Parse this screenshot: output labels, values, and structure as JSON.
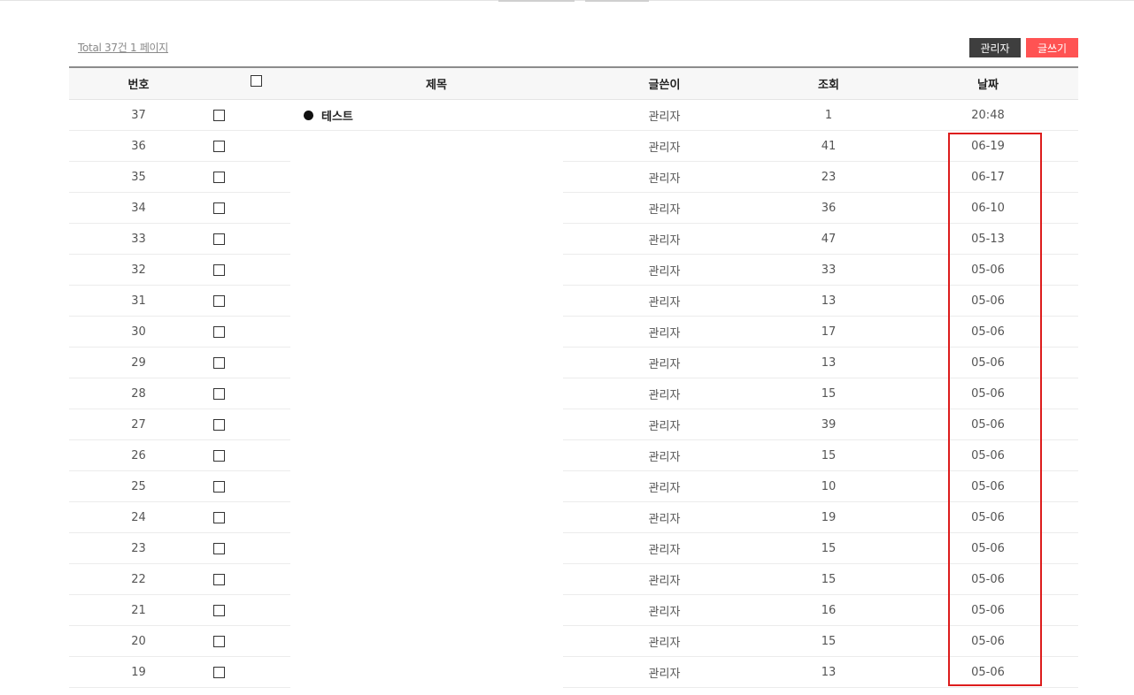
{
  "total_text": "Total 37건 1 페이지",
  "buttons": {
    "admin": "관리자",
    "write": "글쓰기"
  },
  "columns": {
    "number": "번호",
    "title": "제목",
    "author": "글쓴이",
    "views": "조회",
    "date": "날짜"
  },
  "rows": [
    {
      "num": "37",
      "title": "테스트",
      "author": "관리자",
      "views": "1",
      "date": "20:48"
    },
    {
      "num": "36",
      "title": "",
      "author": "관리자",
      "views": "41",
      "date": "06-19"
    },
    {
      "num": "35",
      "title": "",
      "author": "관리자",
      "views": "23",
      "date": "06-17"
    },
    {
      "num": "34",
      "title": "",
      "author": "관리자",
      "views": "36",
      "date": "06-10"
    },
    {
      "num": "33",
      "title": "",
      "author": "관리자",
      "views": "47",
      "date": "05-13"
    },
    {
      "num": "32",
      "title": "",
      "author": "관리자",
      "views": "33",
      "date": "05-06"
    },
    {
      "num": "31",
      "title": "",
      "author": "관리자",
      "views": "13",
      "date": "05-06"
    },
    {
      "num": "30",
      "title": "",
      "author": "관리자",
      "views": "17",
      "date": "05-06"
    },
    {
      "num": "29",
      "title": "",
      "author": "관리자",
      "views": "13",
      "date": "05-06"
    },
    {
      "num": "28",
      "title": "",
      "author": "관리자",
      "views": "15",
      "date": "05-06"
    },
    {
      "num": "27",
      "title": "",
      "author": "관리자",
      "views": "39",
      "date": "05-06"
    },
    {
      "num": "26",
      "title": "",
      "author": "관리자",
      "views": "15",
      "date": "05-06"
    },
    {
      "num": "25",
      "title": "",
      "author": "관리자",
      "views": "10",
      "date": "05-06"
    },
    {
      "num": "24",
      "title": "",
      "author": "관리자",
      "views": "19",
      "date": "05-06"
    },
    {
      "num": "23",
      "title": "",
      "author": "관리자",
      "views": "15",
      "date": "05-06"
    },
    {
      "num": "22",
      "title": "",
      "author": "관리자",
      "views": "15",
      "date": "05-06"
    },
    {
      "num": "21",
      "title": "",
      "author": "관리자",
      "views": "16",
      "date": "05-06"
    },
    {
      "num": "20",
      "title": "",
      "author": "관리자",
      "views": "15",
      "date": "05-06"
    },
    {
      "num": "19",
      "title": "",
      "author": "관리자",
      "views": "13",
      "date": "05-06"
    }
  ],
  "colors": {
    "admin_button": "#3e3e3e",
    "write_button": "#ff5353",
    "highlight": "#dd1c1c"
  }
}
